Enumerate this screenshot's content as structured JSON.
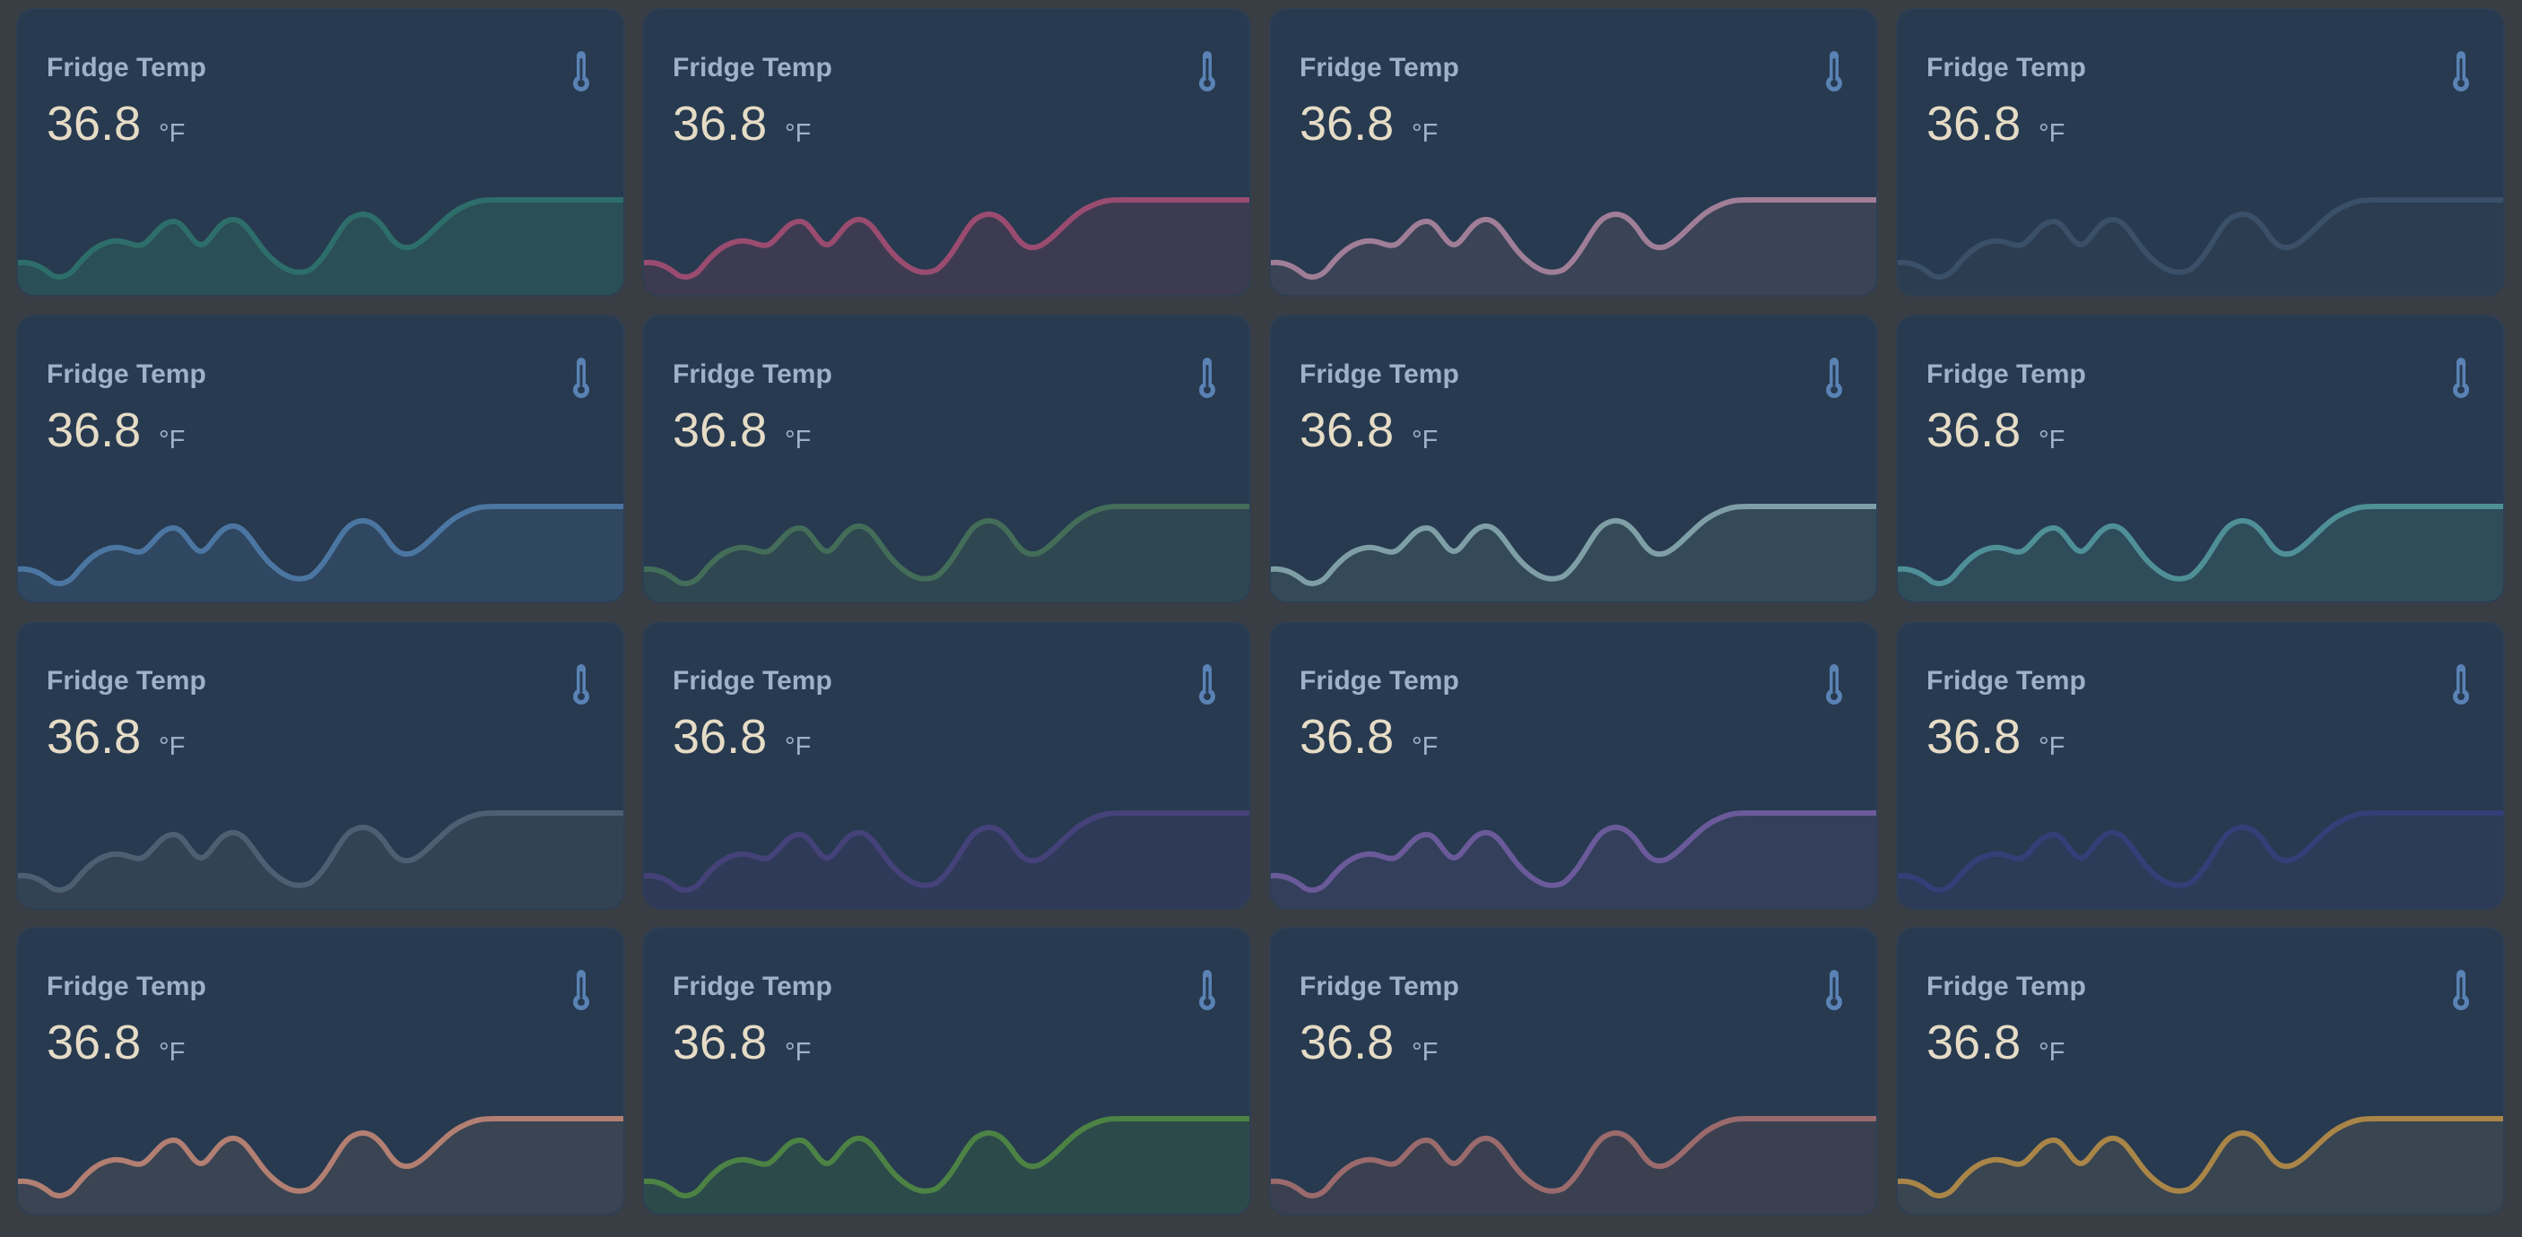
{
  "cards": [
    {
      "name": "Fridge Temp",
      "value": "36.8",
      "unit": "°F",
      "icon": "thermometer-icon",
      "color": "#2e6e6a",
      "fill": "#2a4f55"
    },
    {
      "name": "Fridge Temp",
      "value": "36.8",
      "unit": "°F",
      "icon": "thermometer-icon",
      "color": "#9a4c70",
      "fill": "#3d3b52"
    },
    {
      "name": "Fridge Temp",
      "value": "36.8",
      "unit": "°F",
      "icon": "thermometer-icon",
      "color": "#a07e98",
      "fill": "#3b4356"
    },
    {
      "name": "Fridge Temp",
      "value": "36.8",
      "unit": "°F",
      "icon": "thermometer-icon",
      "color": "#3a4f68",
      "fill": "#2c3d52"
    },
    {
      "name": "Fridge Temp",
      "value": "36.8",
      "unit": "°F",
      "icon": "thermometer-icon",
      "color": "#4c76a2",
      "fill": "#2f4760"
    },
    {
      "name": "Fridge Temp",
      "value": "36.8",
      "unit": "°F",
      "icon": "thermometer-icon",
      "color": "#436d58",
      "fill": "#2f4750"
    },
    {
      "name": "Fridge Temp",
      "value": "36.8",
      "unit": "°F",
      "icon": "thermometer-icon",
      "color": "#7f9fa6",
      "fill": "#344a58"
    },
    {
      "name": "Fridge Temp",
      "value": "36.8",
      "unit": "°F",
      "icon": "thermometer-icon",
      "color": "#4f9097",
      "fill": "#2f4c5a"
    },
    {
      "name": "Fridge Temp",
      "value": "36.8",
      "unit": "°F",
      "icon": "thermometer-icon",
      "color": "#4d6073",
      "fill": "#334354"
    },
    {
      "name": "Fridge Temp",
      "value": "36.8",
      "unit": "°F",
      "icon": "thermometer-icon",
      "color": "#45427a",
      "fill": "#2f3a58"
    },
    {
      "name": "Fridge Temp",
      "value": "36.8",
      "unit": "°F",
      "icon": "thermometer-icon",
      "color": "#6a5a9a",
      "fill": "#343f5c"
    },
    {
      "name": "Fridge Temp",
      "value": "36.8",
      "unit": "°F",
      "icon": "thermometer-icon",
      "color": "#343f78",
      "fill": "#2d3a58"
    },
    {
      "name": "Fridge Temp",
      "value": "36.8",
      "unit": "°F",
      "icon": "thermometer-icon",
      "color": "#b27f72",
      "fill": "#3a4452"
    },
    {
      "name": "Fridge Temp",
      "value": "36.8",
      "unit": "°F",
      "icon": "thermometer-icon",
      "color": "#4c8244",
      "fill": "#2c4a4a"
    },
    {
      "name": "Fridge Temp",
      "value": "36.8",
      "unit": "°F",
      "icon": "thermometer-icon",
      "color": "#9a6a6c",
      "fill": "#3a4050"
    },
    {
      "name": "Fridge Temp",
      "value": "36.8",
      "unit": "°F",
      "icon": "thermometer-icon",
      "color": "#a98548",
      "fill": "#394550"
    }
  ]
}
